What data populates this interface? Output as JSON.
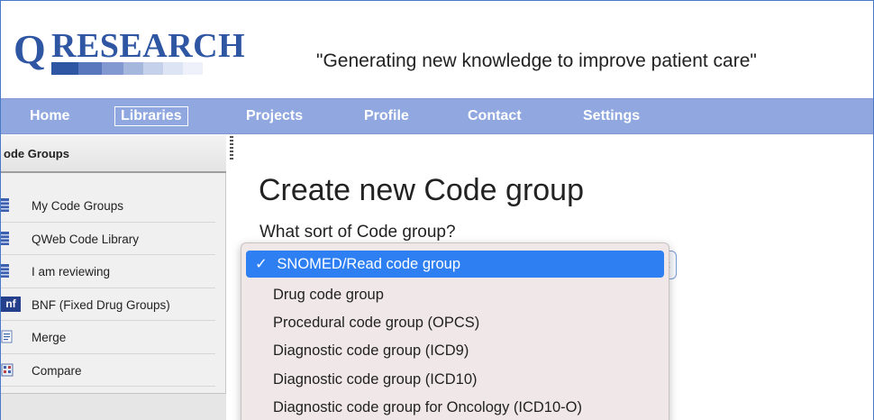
{
  "header": {
    "logo_letter": "Q",
    "logo_text": "RESEARCH",
    "tagline": "\"Generating new knowledge to improve patient care\""
  },
  "nav": {
    "items": [
      {
        "label": "Home",
        "active": false
      },
      {
        "label": "Libraries",
        "active": true
      },
      {
        "label": "Projects",
        "active": false
      },
      {
        "label": "Profile",
        "active": false
      },
      {
        "label": "Contact",
        "active": false
      },
      {
        "label": "Settings",
        "active": false
      }
    ]
  },
  "sidebar": {
    "title": "ode Groups",
    "items": [
      {
        "label": "My Code Groups",
        "icon": "database-icon"
      },
      {
        "label": "QWeb Code Library",
        "icon": "database-icon"
      },
      {
        "label": "I am reviewing",
        "icon": "database-icon"
      },
      {
        "label": "BNF (Fixed Drug Groups)",
        "icon": "bnf-icon",
        "icon_text": "nf"
      },
      {
        "label": "Merge",
        "icon": "merge-icon"
      },
      {
        "label": "Compare",
        "icon": "compare-icon"
      }
    ]
  },
  "main": {
    "title": "Create new Code group",
    "question": "What sort of Code group?"
  },
  "dropdown": {
    "check_mark": "✓",
    "options": [
      {
        "label": "SNOMED/Read code group",
        "selected": true
      },
      {
        "label": "Drug code group",
        "selected": false
      },
      {
        "label": "Procedural code group (OPCS)",
        "selected": false
      },
      {
        "label": "Diagnostic code group (ICD9)",
        "selected": false
      },
      {
        "label": "Diagnostic code group (ICD10)",
        "selected": false
      },
      {
        "label": "Diagnostic code group for Oncology (ICD10-O)",
        "selected": false
      }
    ]
  },
  "colors": {
    "brand_blue": "#2f56a3",
    "nav_bg": "#90a8df",
    "selection_blue": "#2d7ff2"
  }
}
